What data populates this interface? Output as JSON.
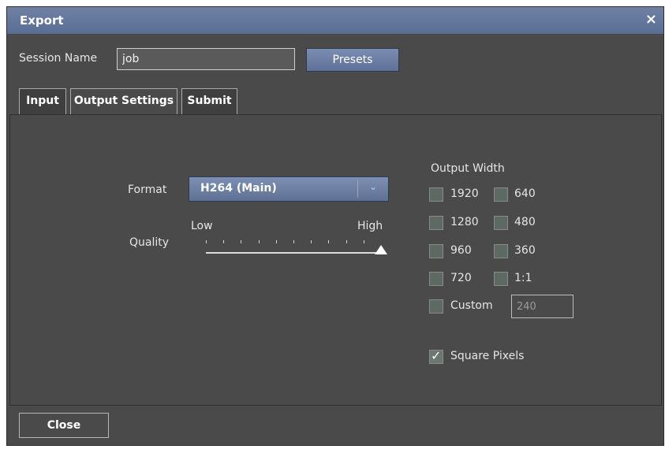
{
  "window": {
    "title": "Export",
    "close_icon": "×"
  },
  "session": {
    "label": "Session Name",
    "value": "job",
    "presets_label": "Presets"
  },
  "tabs": [
    {
      "label": "Input",
      "active": false
    },
    {
      "label": "Output Settings",
      "active": true
    },
    {
      "label": "Submit",
      "active": false
    }
  ],
  "output_settings": {
    "format_label": "Format",
    "format_value": "H264 (Main)",
    "format_arrow": "⌄",
    "quality_label": "Quality",
    "quality_low": "Low",
    "quality_high": "High",
    "quality_level": 1.0,
    "output_width_label": "Output Width",
    "widths": [
      {
        "label": "1920",
        "checked": false
      },
      {
        "label": "640",
        "checked": false
      },
      {
        "label": "1280",
        "checked": false
      },
      {
        "label": "480",
        "checked": false
      },
      {
        "label": "960",
        "checked": false
      },
      {
        "label": "360",
        "checked": false
      },
      {
        "label": "720",
        "checked": false
      },
      {
        "label": "1:1",
        "checked": false
      }
    ],
    "custom_label": "Custom",
    "custom_checked": false,
    "custom_value": "240",
    "square_pixels_label": "Square Pixels",
    "square_pixels_checked": true,
    "check_glyph": "✓"
  },
  "footer": {
    "close_label": "Close"
  }
}
